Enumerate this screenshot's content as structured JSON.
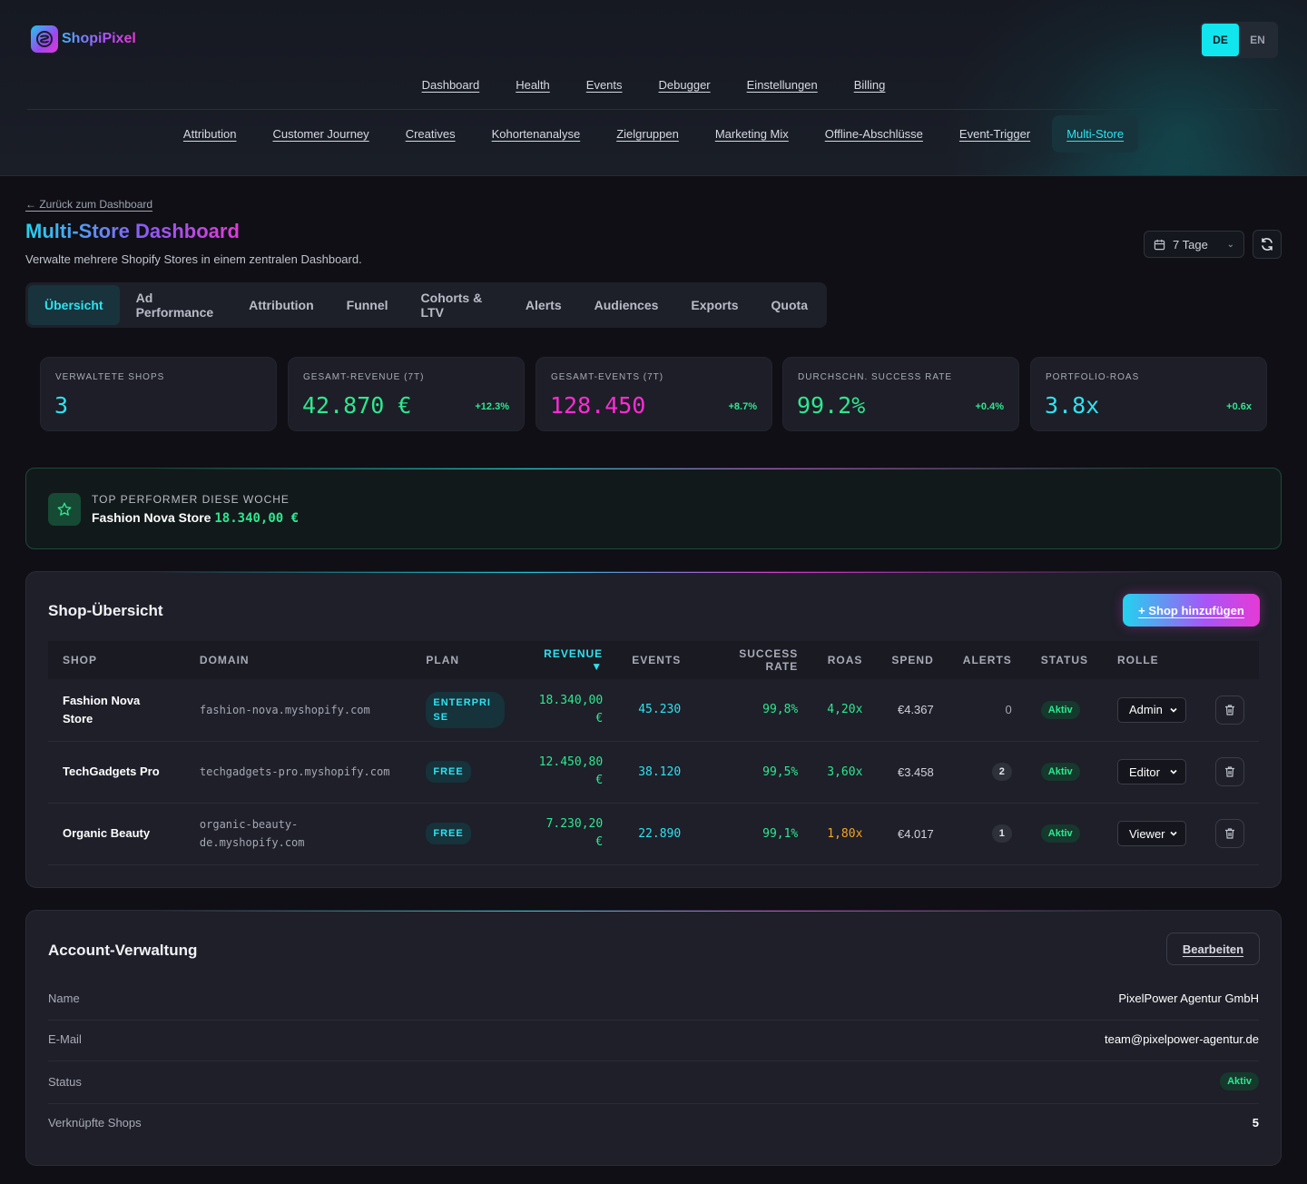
{
  "brand": {
    "name": "ShopiPixel",
    "logo_letter": "SP"
  },
  "language": {
    "options": [
      "DE",
      "EN"
    ],
    "selected": "DE"
  },
  "nav_primary": [
    "Dashboard",
    "Health",
    "Events",
    "Debugger",
    "Einstellungen",
    "Billing"
  ],
  "nav_secondary": [
    "Attribution",
    "Customer Journey",
    "Creatives",
    "Kohortenanalyse",
    "Zielgruppen",
    "Marketing Mix",
    "Offline-Abschlüsse",
    "Event-Trigger",
    "Multi-Store"
  ],
  "nav_secondary_active": "Multi-Store",
  "header": {
    "back_link": "← Zurück zum Dashboard",
    "title": "Multi-Store Dashboard",
    "subtitle": "Verwalte mehrere Shopify Stores in einem zentralen Dashboard.",
    "date_range": "7 Tage"
  },
  "tabs": [
    "Übersicht",
    "Ad Performance",
    "Attribution",
    "Funnel",
    "Cohorts & LTV",
    "Alerts",
    "Audiences",
    "Exports",
    "Quota"
  ],
  "tabs_active": "Übersicht",
  "kpis": [
    {
      "label": "VERWALTETE SHOPS",
      "value": "3",
      "change": "",
      "color": "#2ee2f0"
    },
    {
      "label": "GESAMT-REVENUE (7T)",
      "value": "42.870 €",
      "change": "+12.3%",
      "color": "#2ee88f"
    },
    {
      "label": "GESAMT-EVENTS (7T)",
      "value": "128.450",
      "change": "+8.7%",
      "color": "#ff2bd6"
    },
    {
      "label": "DURCHSCHN. SUCCESS RATE",
      "value": "99.2%",
      "change": "+0.4%",
      "color": "#2ee88f"
    },
    {
      "label": "PORTFOLIO-ROAS",
      "value": "3.8x",
      "change": "+0.6x",
      "color": "#2ee2f0"
    }
  ],
  "top_performer": {
    "label": "TOP PERFORMER DIESE WOCHE",
    "shop": "Fashion Nova Store",
    "value": "18.340,00 €"
  },
  "shops_panel": {
    "title": "Shop-Übersicht",
    "add_button": "+ Shop hinzufügen",
    "columns": [
      "SHOP",
      "DOMAIN",
      "PLAN",
      "REVENUE ▼",
      "EVENTS",
      "SUCCESS RATE",
      "ROAS",
      "SPEND",
      "ALERTS",
      "STATUS",
      "ROLLE"
    ],
    "rows": [
      {
        "shop": "Fashion Nova Store",
        "domain": "fashion-nova.myshopify.com",
        "plan": "ENTERPRISE",
        "revenue": "18.340,00 €",
        "events": "45.230",
        "success_rate": "99,8%",
        "roas": "4,20x",
        "roas_color": "#2ee88f",
        "spend": "€4.367",
        "alerts": "0",
        "status": "Aktiv",
        "role": "Admin"
      },
      {
        "shop": "TechGadgets Pro",
        "domain": "techgadgets-pro.myshopify.com",
        "plan": "FREE",
        "revenue": "12.450,80 €",
        "events": "38.120",
        "success_rate": "99,5%",
        "roas": "3,60x",
        "roas_color": "#2ee88f",
        "spend": "€3.458",
        "alerts": "2",
        "status": "Aktiv",
        "role": "Editor"
      },
      {
        "shop": "Organic Beauty",
        "domain": "organic-beauty-de.myshopify.com",
        "plan": "FREE",
        "revenue": "7.230,20 €",
        "events": "22.890",
        "success_rate": "99,1%",
        "roas": "1,80x",
        "roas_color": "#f5a524",
        "spend": "€4.017",
        "alerts": "1",
        "status": "Aktiv",
        "role": "Viewer"
      }
    ]
  },
  "account_panel": {
    "title": "Account-Verwaltung",
    "edit_button": "Bearbeiten",
    "rows": [
      {
        "key": "Name",
        "value": "PixelPower Agentur GmbH"
      },
      {
        "key": "E-Mail",
        "value": "team@pixelpower-agentur.de"
      },
      {
        "key": "Status",
        "value": "Aktiv"
      },
      {
        "key": "Verknüpfte Shops",
        "value": "5"
      }
    ]
  }
}
